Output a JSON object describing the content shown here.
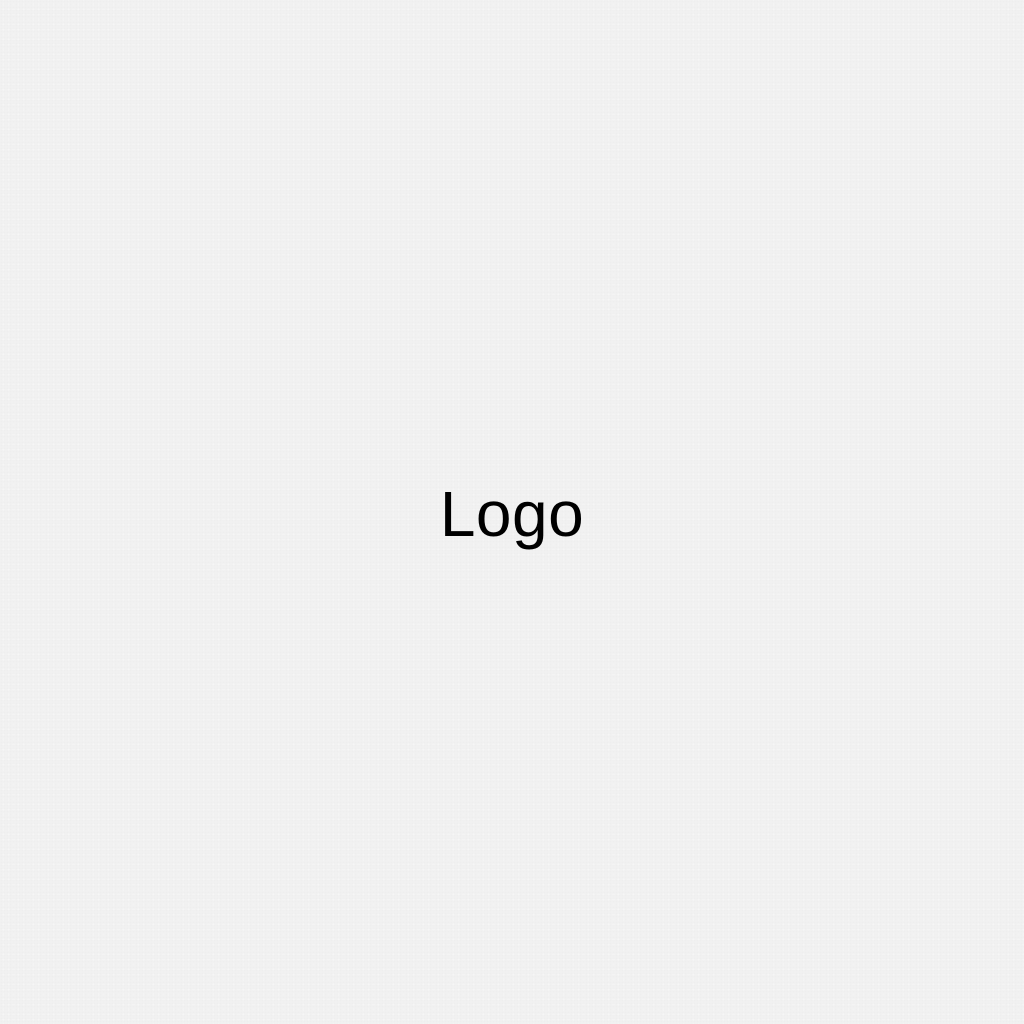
{
  "logo": {
    "text": "Logo"
  },
  "colors": {
    "background": "#f1f1f1",
    "text": "#000000"
  }
}
